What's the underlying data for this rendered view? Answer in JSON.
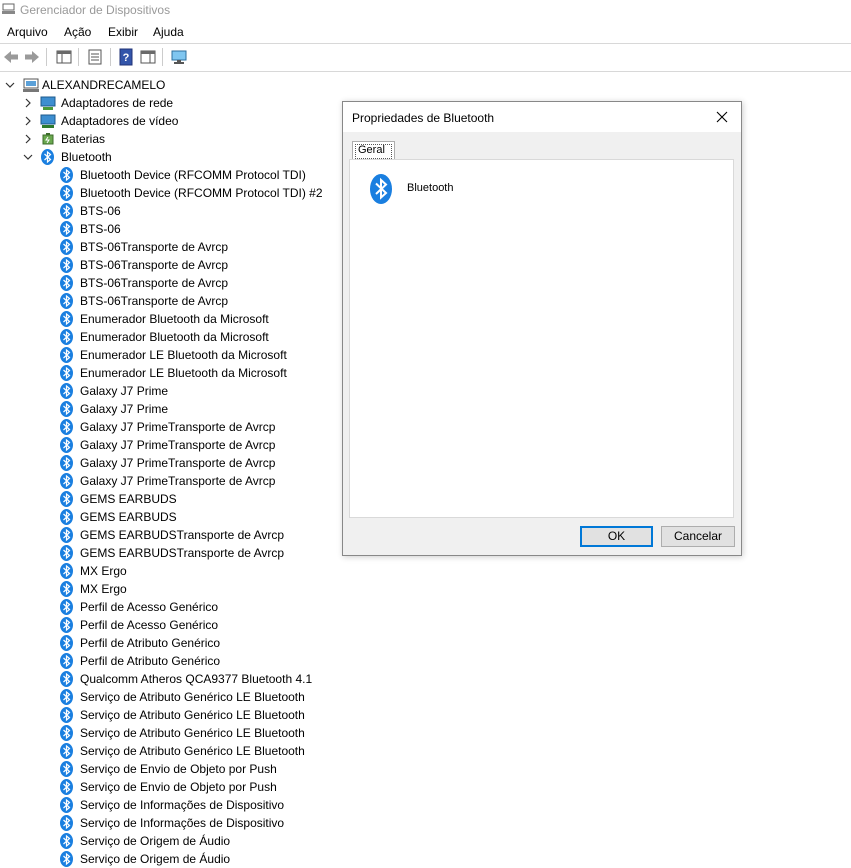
{
  "window": {
    "title": "Gerenciador de Dispositivos"
  },
  "menu": [
    "Arquivo",
    "Ação",
    "Exibir",
    "Ajuda"
  ],
  "toolbar": {
    "buttons": [
      "back-arrow-icon",
      "forward-arrow-icon",
      "show-hide-console-tree-icon",
      "properties-icon",
      "help-icon",
      "action-pane-icon",
      "monitor-icon"
    ]
  },
  "tree": {
    "root": "ALEXANDRECAMELO",
    "categories": [
      {
        "label": "Adaptadores de rede",
        "icon": "network-adapter-icon",
        "expanded": false
      },
      {
        "label": "Adaptadores de vídeo",
        "icon": "display-adapter-icon",
        "expanded": false
      },
      {
        "label": "Baterias",
        "icon": "battery-icon",
        "expanded": false
      },
      {
        "label": "Bluetooth",
        "icon": "bluetooth-icon",
        "expanded": true
      }
    ],
    "bluetooth_devices": [
      "Bluetooth Device (RFCOMM Protocol TDI)",
      "Bluetooth Device (RFCOMM Protocol TDI) #2",
      "BTS-06",
      "BTS-06",
      "BTS-06Transporte de Avrcp",
      "BTS-06Transporte de Avrcp",
      "BTS-06Transporte de Avrcp",
      "BTS-06Transporte de Avrcp",
      "Enumerador Bluetooth da Microsoft",
      "Enumerador Bluetooth da Microsoft",
      "Enumerador LE Bluetooth da Microsoft",
      "Enumerador LE Bluetooth da Microsoft",
      "Galaxy J7 Prime",
      "Galaxy J7 Prime",
      "Galaxy J7 PrimeTransporte de Avrcp",
      "Galaxy J7 PrimeTransporte de Avrcp",
      "Galaxy J7 PrimeTransporte de Avrcp",
      "Galaxy J7 PrimeTransporte de Avrcp",
      "GEMS EARBUDS",
      "GEMS EARBUDS",
      "GEMS EARBUDSTransporte de Avrcp",
      "GEMS EARBUDSTransporte de Avrcp",
      "MX Ergo",
      "MX Ergo",
      "Perfil de Acesso Genérico",
      "Perfil de Acesso Genérico",
      "Perfil de Atributo Genérico",
      "Perfil de Atributo Genérico",
      "Qualcomm Atheros QCA9377 Bluetooth 4.1",
      "Serviço de Atributo Genérico LE Bluetooth",
      "Serviço de Atributo Genérico LE Bluetooth",
      "Serviço de Atributo Genérico LE Bluetooth",
      "Serviço de Atributo Genérico LE Bluetooth",
      "Serviço de Envio de Objeto por Push",
      "Serviço de Envio de Objeto por Push",
      "Serviço de Informações de Dispositivo",
      "Serviço de Informações de Dispositivo",
      "Serviço de Origem de Áudio",
      "Serviço de Origem de Áudio"
    ]
  },
  "dialog": {
    "title": "Propriedades de Bluetooth",
    "close_glyph": "✕",
    "tab": "Geral",
    "device_name": "Bluetooth",
    "ok_label": "OK",
    "cancel_label": "Cancelar"
  },
  "colors": {
    "bluetooth_blue": "#1a7fe0",
    "ok_border": "#0078d7"
  }
}
